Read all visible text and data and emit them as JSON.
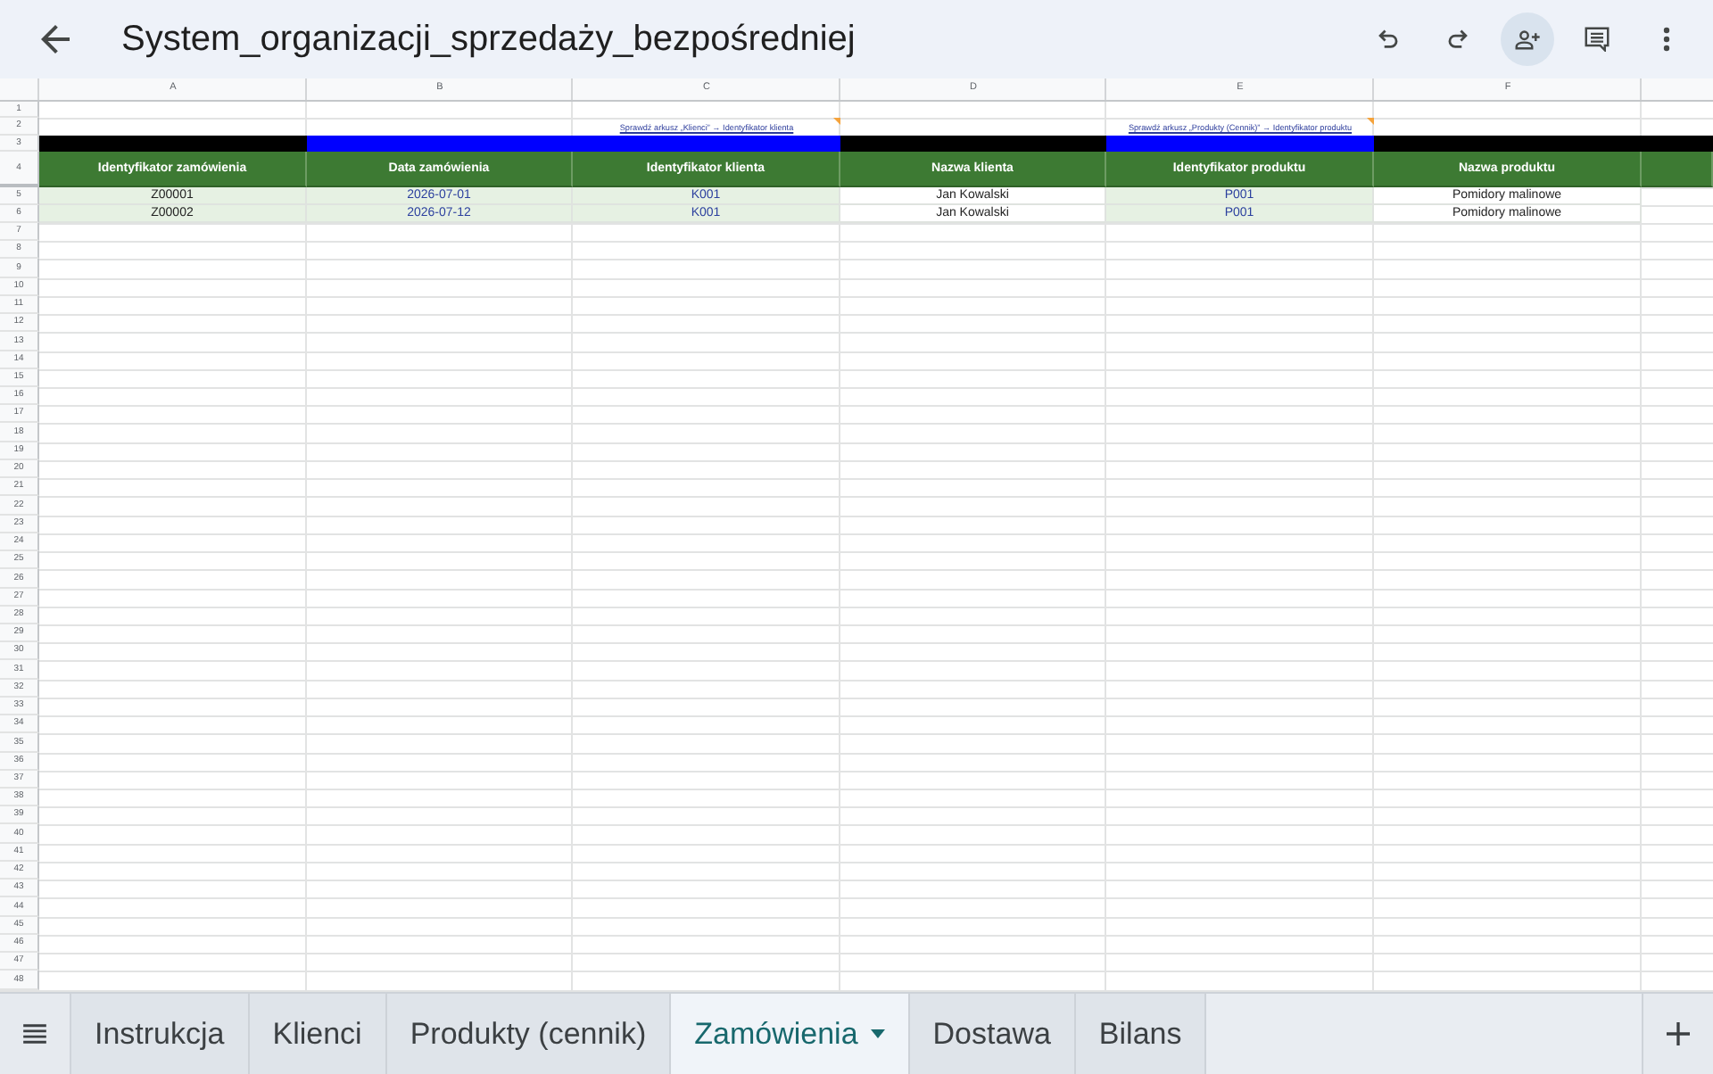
{
  "window": {
    "title": "System_organizacji_sprzedaży_bezpośredniej"
  },
  "sheet": {
    "columns": [
      {
        "letter": "A",
        "header": "Identyfikator zamówienia",
        "kind": "id"
      },
      {
        "letter": "B",
        "header": "Data zamówienia",
        "kind": "input"
      },
      {
        "letter": "C",
        "link": "Sprawdź arkusz „Klienci” → Identyfikator klienta",
        "note": true,
        "header": "Identyfikator klienta",
        "kind": "input"
      },
      {
        "letter": "D",
        "header": "Nazwa klienta",
        "kind": "auto"
      },
      {
        "letter": "E",
        "link": "Sprawdź arkusz „Produkty (Cennik)” → Identyfikator produktu",
        "note": true,
        "header": "Identyfikator produktu",
        "kind": "input"
      },
      {
        "letter": "F",
        "header": "Nazwa produktu",
        "kind": "auto"
      }
    ],
    "bands": [
      {
        "color": "#000000"
      },
      {
        "color": "#0000ff"
      },
      {
        "color": "#0000ff"
      },
      {
        "color": "#000000"
      },
      {
        "color": "#0000ff"
      },
      {
        "color": "#000000"
      },
      {
        "color": "#000000"
      }
    ],
    "top_row_numbers": [
      "1",
      "2",
      "3",
      "4"
    ],
    "rows": [
      {
        "number": "5",
        "cells": [
          "Z00001",
          "2026-07-01",
          "K001",
          "Jan Kowalski",
          "P001",
          "Pomidory malinowe"
        ]
      },
      {
        "number": "6",
        "cells": [
          "Z00002",
          "2026-07-12",
          "K001",
          "Jan Kowalski",
          "P001",
          "Pomidory malinowe"
        ]
      },
      {
        "number": "7"
      },
      {
        "number": "8"
      },
      {
        "number": "9"
      },
      {
        "number": "10"
      },
      {
        "number": "11"
      },
      {
        "number": "12"
      },
      {
        "number": "13"
      },
      {
        "number": "14"
      },
      {
        "number": "15"
      },
      {
        "number": "16"
      },
      {
        "number": "17"
      },
      {
        "number": "18"
      },
      {
        "number": "19"
      },
      {
        "number": "20"
      },
      {
        "number": "21"
      },
      {
        "number": "22"
      },
      {
        "number": "23"
      },
      {
        "number": "24"
      },
      {
        "number": "25"
      },
      {
        "number": "26"
      },
      {
        "number": "27"
      },
      {
        "number": "28"
      },
      {
        "number": "29"
      },
      {
        "number": "30"
      },
      {
        "number": "31"
      },
      {
        "number": "32"
      },
      {
        "number": "33"
      },
      {
        "number": "34"
      },
      {
        "number": "35"
      },
      {
        "number": "36"
      },
      {
        "number": "37"
      },
      {
        "number": "38"
      },
      {
        "number": "39"
      },
      {
        "number": "40"
      },
      {
        "number": "41"
      },
      {
        "number": "42"
      },
      {
        "number": "43"
      },
      {
        "number": "44"
      },
      {
        "number": "45"
      },
      {
        "number": "46"
      },
      {
        "number": "47"
      },
      {
        "number": "48"
      }
    ]
  },
  "tabs": [
    {
      "label": "Instrukcja",
      "selected": false
    },
    {
      "label": "Klienci",
      "selected": false
    },
    {
      "label": "Produkty (cennik)",
      "selected": false
    },
    {
      "label": "Zamówienia",
      "selected": true
    },
    {
      "label": "Dostawa",
      "selected": false
    },
    {
      "label": "Bilans",
      "selected": false
    }
  ]
}
